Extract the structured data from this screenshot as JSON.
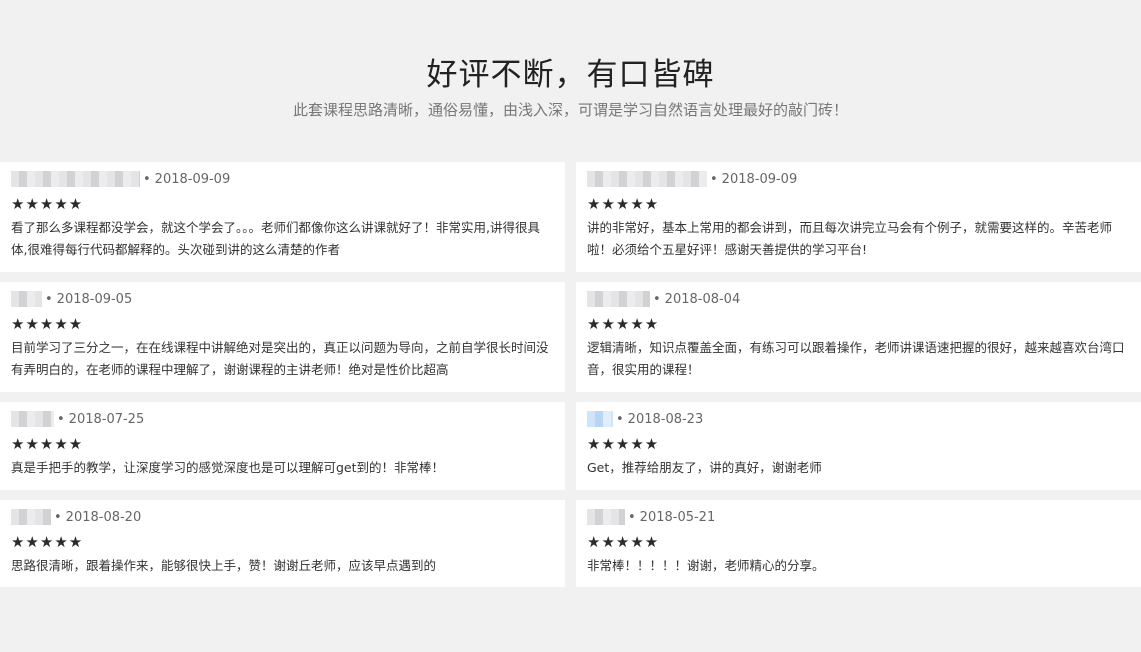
{
  "header": {
    "title": "好评不断，有口皆碑",
    "subtitle": "此套课程思路清晰，通俗易懂，由浅入深，可谓是学习自然语言处理最好的敲门砖！"
  },
  "reviews": [
    {
      "date": "2018-09-09",
      "stars": "★★★★★",
      "text": "看了那么多课程都没学会，就这个学会了。。。老师们都像你这么讲课就好了！非常实用,讲得很具体,很难得每行代码都解释的。头次碰到讲的这么清楚的作者"
    },
    {
      "date": "2018-09-09",
      "stars": "★★★★★",
      "text": "讲的非常好，基本上常用的都会讲到，而且每次讲完立马会有个例子，就需要这样的。辛苦老师啦！必须给个五星好评！感谢天善提供的学习平台!"
    },
    {
      "date": "2018-09-05",
      "stars": "★★★★★",
      "text": "目前学习了三分之一，在在线课程中讲解绝对是突出的，真正以问题为导向，之前自学很长时间没有弄明白的，在老师的课程中理解了，谢谢课程的主讲老师！绝对是性价比超高"
    },
    {
      "date": "2018-08-04",
      "stars": "★★★★★",
      "text": "逻辑清晰，知识点覆盖全面，有练习可以跟着操作，老师讲课语速把握的很好，越来越喜欢台湾口音，很实用的课程！"
    },
    {
      "date": "2018-07-25",
      "stars": "★★★★★",
      "text": "真是手把手的教学，让深度学习的感觉深度也是可以理解可get到的！非常棒！"
    },
    {
      "date": "2018-08-23",
      "stars": "★★★★★",
      "text": "Get，推荐给朋友了，讲的真好，谢谢老师"
    },
    {
      "date": "2018-08-20",
      "stars": "★★★★★",
      "text": "思路很清晰，跟着操作来，能够很快上手，赞！谢谢丘老师，应该早点遇到的"
    },
    {
      "date": "2018-05-21",
      "stars": "★★★★★",
      "text": "非常棒！！！！！谢谢，老师精心的分享。"
    }
  ]
}
